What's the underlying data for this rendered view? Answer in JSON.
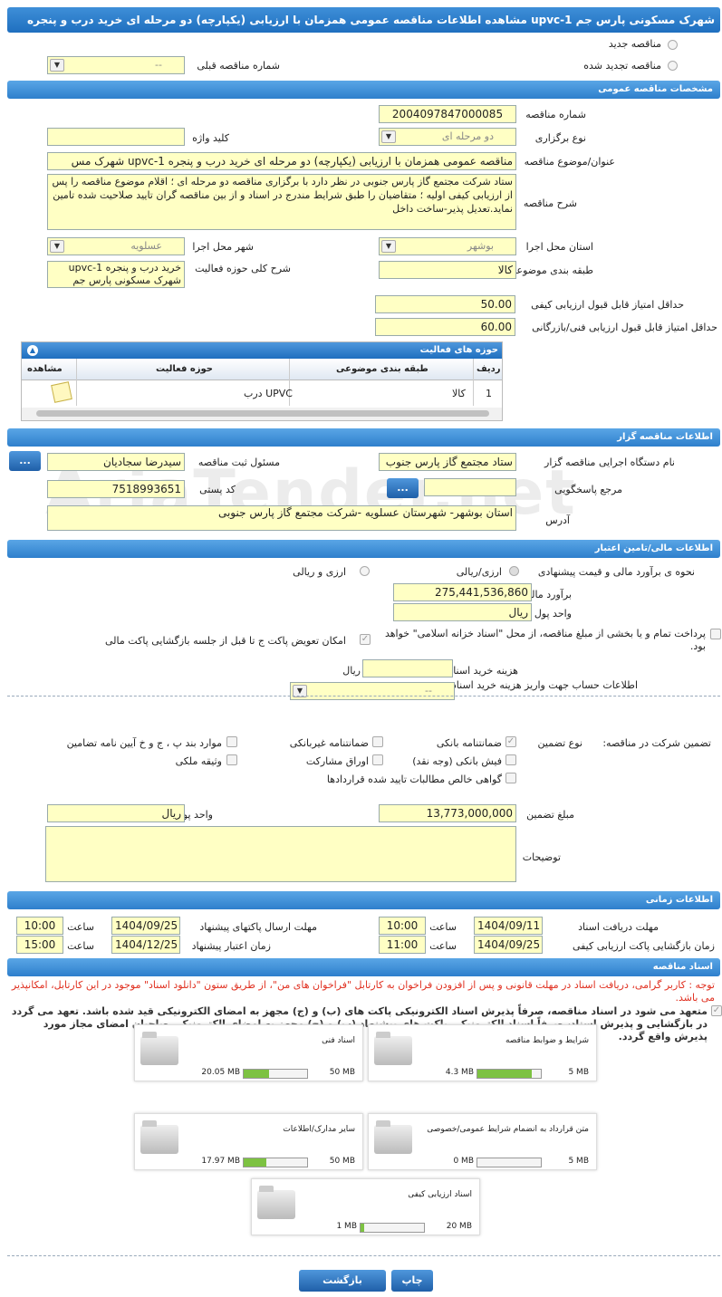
{
  "title": "مشاهده اطلاعات مناقصه عمومی همزمان با ارزیابی (یکپارچه) دو مرحله ای خرید درب و پنجره upvc-1 شهرک مسکونی پارس جم",
  "top": {
    "new_tender": "مناقصه جدید",
    "renewed_tender": "مناقصه تجدید شده",
    "prev_tender_label": "شماره مناقصه قبلی",
    "prev_tender_value": "--"
  },
  "general": {
    "header": "مشخصات مناقصه عمومی",
    "number_label": "شماره مناقصه",
    "number": "2004097847000085",
    "type_label": "نوع برگزاری",
    "type": "دو مرحله ای",
    "keyword_label": "کلید واژه",
    "subject_label": "عنوان/موضوع مناقصه",
    "subject": "مناقصه عمومی همزمان با ارزیابی (یکپارچه) دو مرحله ای خرید درب و پنجره upvc-1 شهرک مس",
    "desc_label": "شرح مناقصه",
    "desc": "ستاد شرکت مجتمع گاز پارس جنوبی در نظر دارد با برگزاری مناقصه دو مرحله ای ؛ اقلام موضوع مناقصه را پس از ارزیابی کیفی اولیه ؛ متقاضیان را طبق شرایط مندرج در اسناد و از بین مناقصه گران تایید صلاحیت شده تامین نماید.تعدیل پذیر-ساخت داخل",
    "province_label": "استان محل اجرا",
    "province": "بوشهر",
    "city_label": "شهر محل اجرا",
    "city": "عسلویه",
    "category_label": "طبقه بندی موضوعی",
    "category": "کالا",
    "scope_label": "شرح کلی حوزه فعالیت",
    "scope": "خرید درب و پنجره upvc-1 شهرک مسکونی پارس جم",
    "min_quality_label": "حداقل امتیاز قابل قبول ارزیابی کیفی",
    "min_quality": "50.00",
    "min_tech_label": "حداقل امتیاز قابل قبول ارزیابی فنی/بازرگانی",
    "min_tech": "60.00"
  },
  "activity": {
    "header": "حوزه های فعالیت",
    "cols": [
      "ردیف",
      "طبقه بندی موضوعی",
      "حوزه فعالیت",
      "مشاهده"
    ],
    "rows": [
      {
        "idx": "1",
        "cat": "کالا",
        "field": "درب UPVC"
      }
    ]
  },
  "organizer": {
    "header": "اطلاعات مناقصه گزار",
    "org_label": "نام دستگاه اجرایی مناقصه گزار",
    "org": "ستاد مجتمع گاز پارس جنوب",
    "resp_label": "مسئول ثبت مناقصه",
    "resp": "سیدرضا سجادیان",
    "ref_label": "مرجع پاسخگویی",
    "postal_label": "کد پستی",
    "postal": "7518993651",
    "address_label": "آدرس",
    "address": "استان بوشهر- شهرستان عسلویه -شرکت مجتمع گاز پارس جنوبی",
    "btn": "..."
  },
  "finance": {
    "header": "اطلاعات مالی/تامین اعتبار",
    "method_label": "نحوه ی برآورد مالی و قیمت پیشنهادی",
    "opt1": "ارزی/ریالی",
    "opt2": "ارزی و ریالی",
    "estimate_label": "برآورد مالی",
    "estimate": "275,441,536,860",
    "currency_label": "واحد پول",
    "currency": "ریال",
    "pay_label": "پرداخت تمام و یا بخشی از مبلغ مناقصه، از محل \"اسناد خزانه اسلامی\" خواهد بود.",
    "swap_label": "امکان تعویض پاکت ج تا قبل از جلسه بازگشایی پاکت مالی",
    "doc_cost_label": "هزینه خرید اسناد",
    "doc_cost_unit": "ریال",
    "account_label": "اطلاعات حساب جهت واریز هزینه خرید اسناد",
    "account": "--"
  },
  "guarantee": {
    "label": "تضمین شرکت در مناقصه:",
    "type_label": "نوع تضمین",
    "items": [
      "ضمانتنامه بانکی",
      "ضمانتنامه غیربانکی",
      "موارد بند پ ، ج و خ آیین نامه تضامین",
      "فیش بانکی (وجه نقد)",
      "اوراق مشارکت",
      "وثیقه ملکی",
      "گواهی خالص مطالبات تایید شده قراردادها"
    ],
    "amount_label": "مبلغ تضمین",
    "amount": "13,773,000,000",
    "currency_label": "واحد پول",
    "currency": "ریال",
    "desc_label": "توضیحات"
  },
  "time": {
    "header": "اطلاعات زمانی",
    "recv_label": "مهلت دریافت اسناد",
    "recv_date": "1404/09/11",
    "recv_time": "10:00",
    "send_label": "مهلت ارسال پاکتهای پیشنهاد",
    "send_date": "1404/09/25",
    "send_time": "10:00",
    "open_label": "زمان بازگشایی پاکت ارزیابی کیفی",
    "open_date": "1404/09/25",
    "open_time": "11:00",
    "valid_label": "زمان اعتبار پیشنهاد",
    "valid_date": "1404/12/25",
    "valid_time": "15:00",
    "hour": "ساعت"
  },
  "docs": {
    "header": "اسناد مناقصه",
    "warn": "توجه : کاربر گرامی، دریافت اسناد در مهلت قانونی و پس از افزودن فراخوان به کارتابل \"فراخوان های من\"، از طریق ستون \"دانلود اسناد\" موجود در این کارتابل، امکانپذیر می باشد.",
    "commit": "متعهد می شود در اسناد مناقصه، صرفاً پذیرش اسناد الکترونیکی پاکت های (ب) و (ج) مجهز به امضای الکترونیکی قید شده باشد. تعهد می گردد در بازگشایی و پذیرش اسناد، صرفاً اسناد الکترونیکی پاکت های پیشنهاد (ب) و (ج) مجهز به امضای الکترونیکی صاحبان امضای مجاز مورد پذیرش واقع گردد.",
    "files": [
      {
        "name": "شرایط و ضوابط مناقصه",
        "cur": "4.3 MB",
        "max": "5 MB",
        "fill": 0.86
      },
      {
        "name": "اسناد فنی",
        "cur": "20.05 MB",
        "max": "50 MB",
        "fill": 0.4
      },
      {
        "name": "متن قرارداد به انضمام شرایط عمومی/خصوصی",
        "cur": "0 MB",
        "max": "5 MB",
        "fill": 0
      },
      {
        "name": "سایر مدارک/اطلاعات",
        "cur": "17.97 MB",
        "max": "50 MB",
        "fill": 0.36
      },
      {
        "name": "اسناد ارزیابی کیفی",
        "cur": "1 MB",
        "max": "20 MB",
        "fill": 0.05
      }
    ]
  },
  "buttons": {
    "back": "بازگشت",
    "print": "چاپ"
  },
  "watermark": "AriaTender.net"
}
